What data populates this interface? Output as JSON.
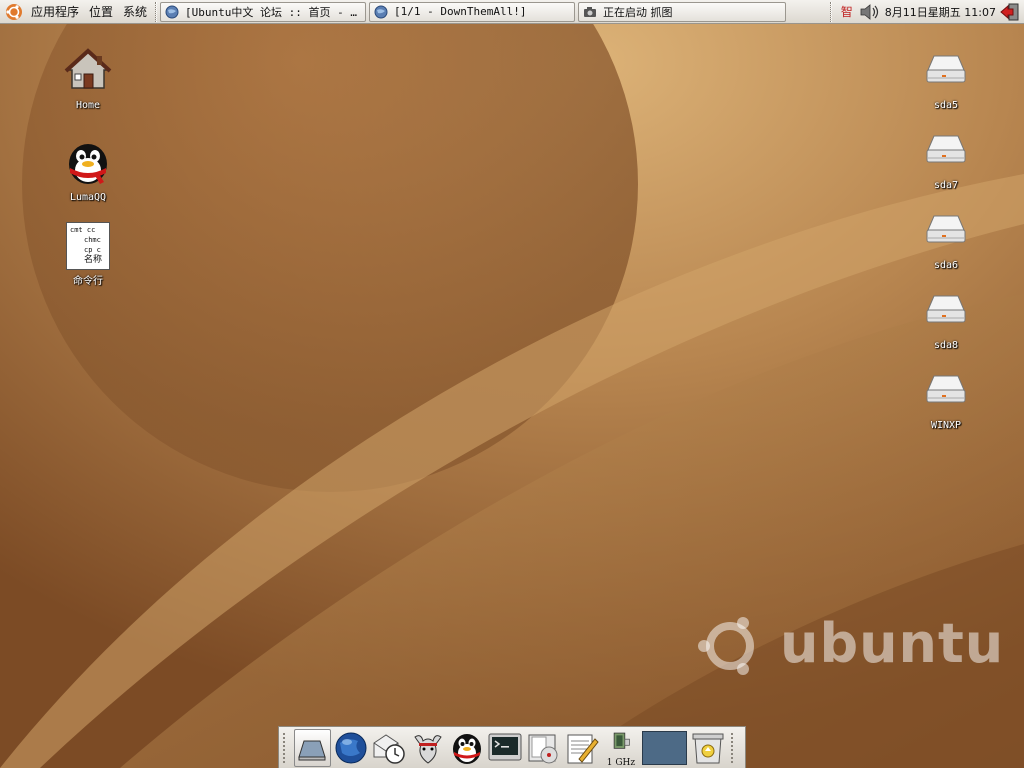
{
  "top_panel": {
    "menus": [
      "应用程序",
      "位置",
      "系统"
    ],
    "tasks": [
      {
        "label": "[Ubuntu中文 论坛 :: 首页 - …",
        "icon": "globe-icon"
      },
      {
        "label": "[1/1 - DownThemAll!]",
        "icon": "globe-icon"
      },
      {
        "label": "正在启动 抓图",
        "icon": "camera-icon"
      }
    ],
    "tray": {
      "ime": "智",
      "clock": "8月11日星期五 11:07"
    }
  },
  "desktop": {
    "left_icons": [
      {
        "label": "Home",
        "icon": "home-icon"
      },
      {
        "label": "LumaQQ",
        "icon": "qq-penguin-icon"
      },
      {
        "label": "命令行",
        "icon": "script-icon"
      }
    ],
    "right_icons": [
      {
        "label": "sda5",
        "icon": "drive-icon"
      },
      {
        "label": "sda7",
        "icon": "drive-icon"
      },
      {
        "label": "sda6",
        "icon": "drive-icon"
      },
      {
        "label": "sda8",
        "icon": "drive-icon"
      },
      {
        "label": "WINXP",
        "icon": "drive-icon"
      }
    ],
    "script_icon_text": [
      "cmt cc",
      "chmc",
      "cp c",
      "名称"
    ],
    "watermark": "ubuntu"
  },
  "dock": {
    "items": [
      "show-desktop-icon",
      "firefox-icon",
      "mail-clock-icon",
      "gnu-icon",
      "qq-penguin-icon",
      "terminal-icon",
      "cd-player-icon",
      "text-editor-icon",
      "cpu-freq-icon",
      "workspace-switcher",
      "trash-icon"
    ],
    "cpu_freq": "1 GHz"
  },
  "colors": {
    "wallpaper_dark": "#7a4a24",
    "wallpaper_light": "#d9ad6e",
    "panel": "#e8e5df"
  }
}
